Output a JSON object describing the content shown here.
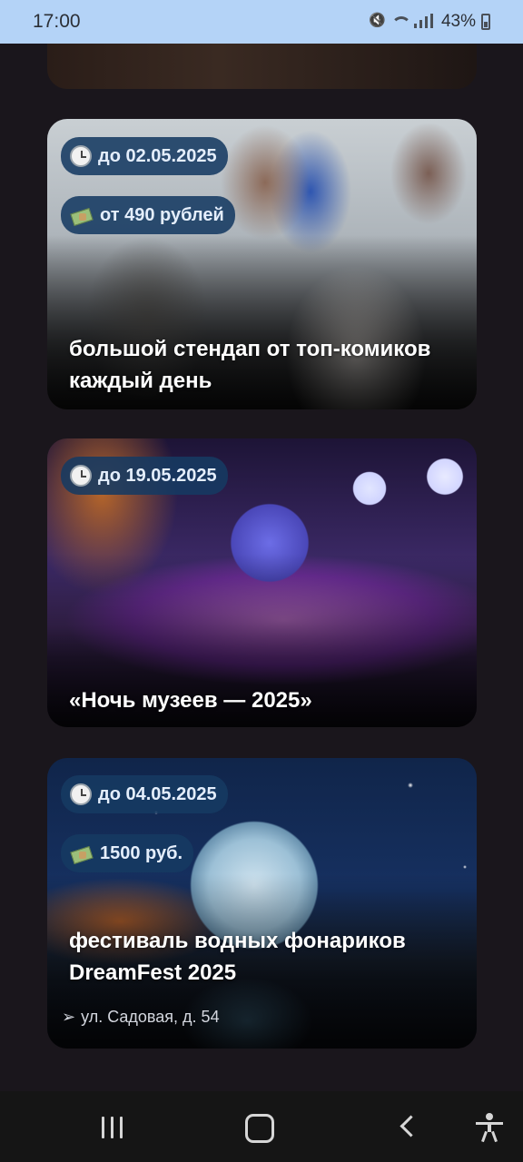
{
  "status_bar": {
    "time": "17:00",
    "battery": "43%",
    "icons": [
      "mute-icon",
      "wifi-icon",
      "signal-icon",
      "battery-icon"
    ]
  },
  "events": [
    {
      "date": "до 02.05.2025",
      "price": "от 490 рублей",
      "title": "большой стендап от топ-комиков каждый день"
    },
    {
      "date": "до 19.05.2025",
      "title": "«Ночь музеев — 2025»"
    },
    {
      "date": "до 04.05.2025",
      "price": "1500 руб.",
      "title": "фестиваль водных фонариков DreamFest 2025",
      "address": "ул. Садовая, д. 54"
    }
  ],
  "icons": {
    "date": "clock-icon",
    "price": "money-icon",
    "address": "arrow-icon"
  },
  "nav_bar": {
    "buttons": [
      "recent-apps-button",
      "home-button",
      "back-button",
      "accessibility-button"
    ]
  }
}
